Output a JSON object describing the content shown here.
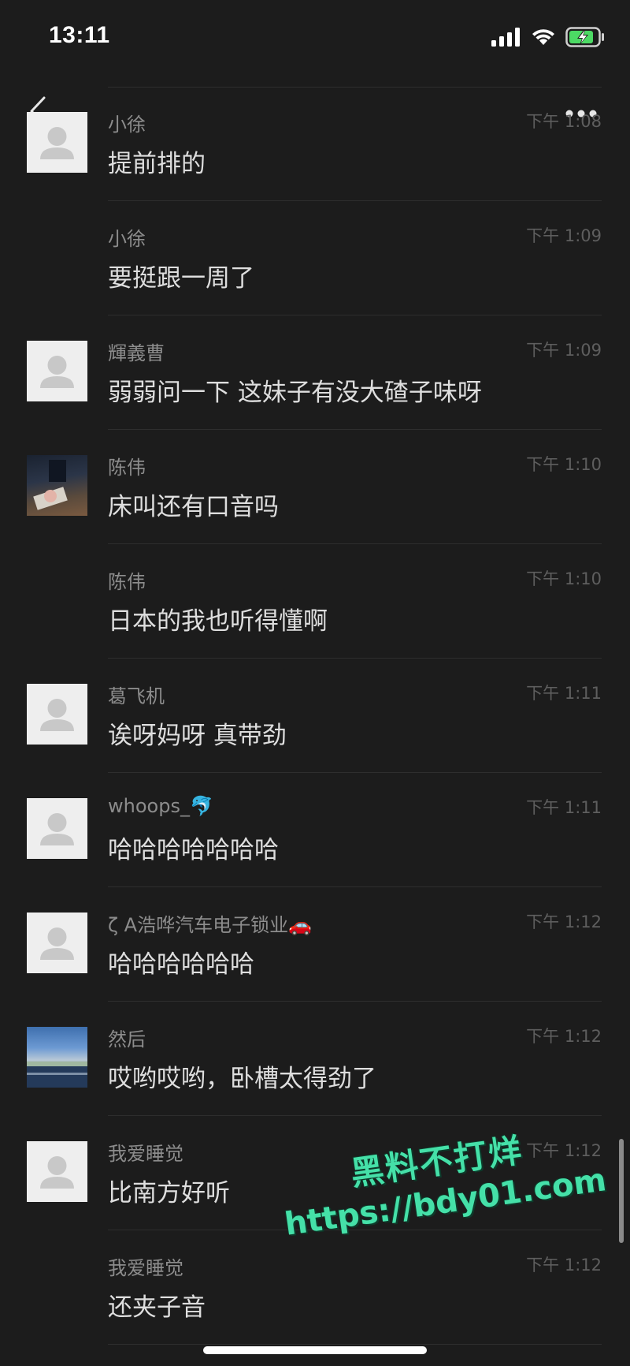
{
  "status_bar": {
    "time": "13:11",
    "icons": [
      "signal-icon",
      "wifi-icon",
      "battery-charging-icon"
    ],
    "battery_color": "#4cd964"
  },
  "nav": {
    "back_icon": "back-icon",
    "more_icon": "more-icon"
  },
  "messages": [
    {
      "sender": "小徐",
      "time": "下午 1:08",
      "text": "提前排的",
      "avatar": "default"
    },
    {
      "sender": "小徐",
      "time": "下午 1:09",
      "text": "要挺跟一周了",
      "avatar": "none"
    },
    {
      "sender": "輝義曹",
      "time": "下午 1:09",
      "text": "弱弱问一下 这妹子有没大碴子味呀",
      "avatar": "default"
    },
    {
      "sender": "陈伟",
      "time": "下午 1:10",
      "text": "床叫还有口音吗",
      "avatar": "photo"
    },
    {
      "sender": "陈伟",
      "time": "下午 1:10",
      "text": "日本的我也听得懂啊",
      "avatar": "none"
    },
    {
      "sender": "葛飞机",
      "time": "下午 1:11",
      "text": "诶呀妈呀 真带劲",
      "avatar": "default"
    },
    {
      "sender": "whoops_🐬",
      "time": "下午 1:11",
      "text": "哈哈哈哈哈哈哈",
      "avatar": "default"
    },
    {
      "sender": "ζ A浩哗汽车电子锁业🚗",
      "time": "下午 1:12",
      "text": "哈哈哈哈哈哈",
      "avatar": "default"
    },
    {
      "sender": "然后",
      "time": "下午 1:12",
      "text": "哎哟哎哟，卧槽太得劲了",
      "avatar": "photo"
    },
    {
      "sender": "我爱睡觉",
      "time": "下午 1:12",
      "text": "比南方好听",
      "avatar": "default"
    },
    {
      "sender": "我爱睡觉",
      "time": "下午 1:12",
      "text": "还夹子音",
      "avatar": "none"
    }
  ],
  "watermark": {
    "line1": "黑料不打烊",
    "line2": "https://bdy01.com",
    "color": "#45e0a8"
  },
  "colors": {
    "background": "#1c1c1c",
    "sender": "#8c8c8c",
    "message_text": "#dedede",
    "timestamp": "#5e5e5e"
  }
}
